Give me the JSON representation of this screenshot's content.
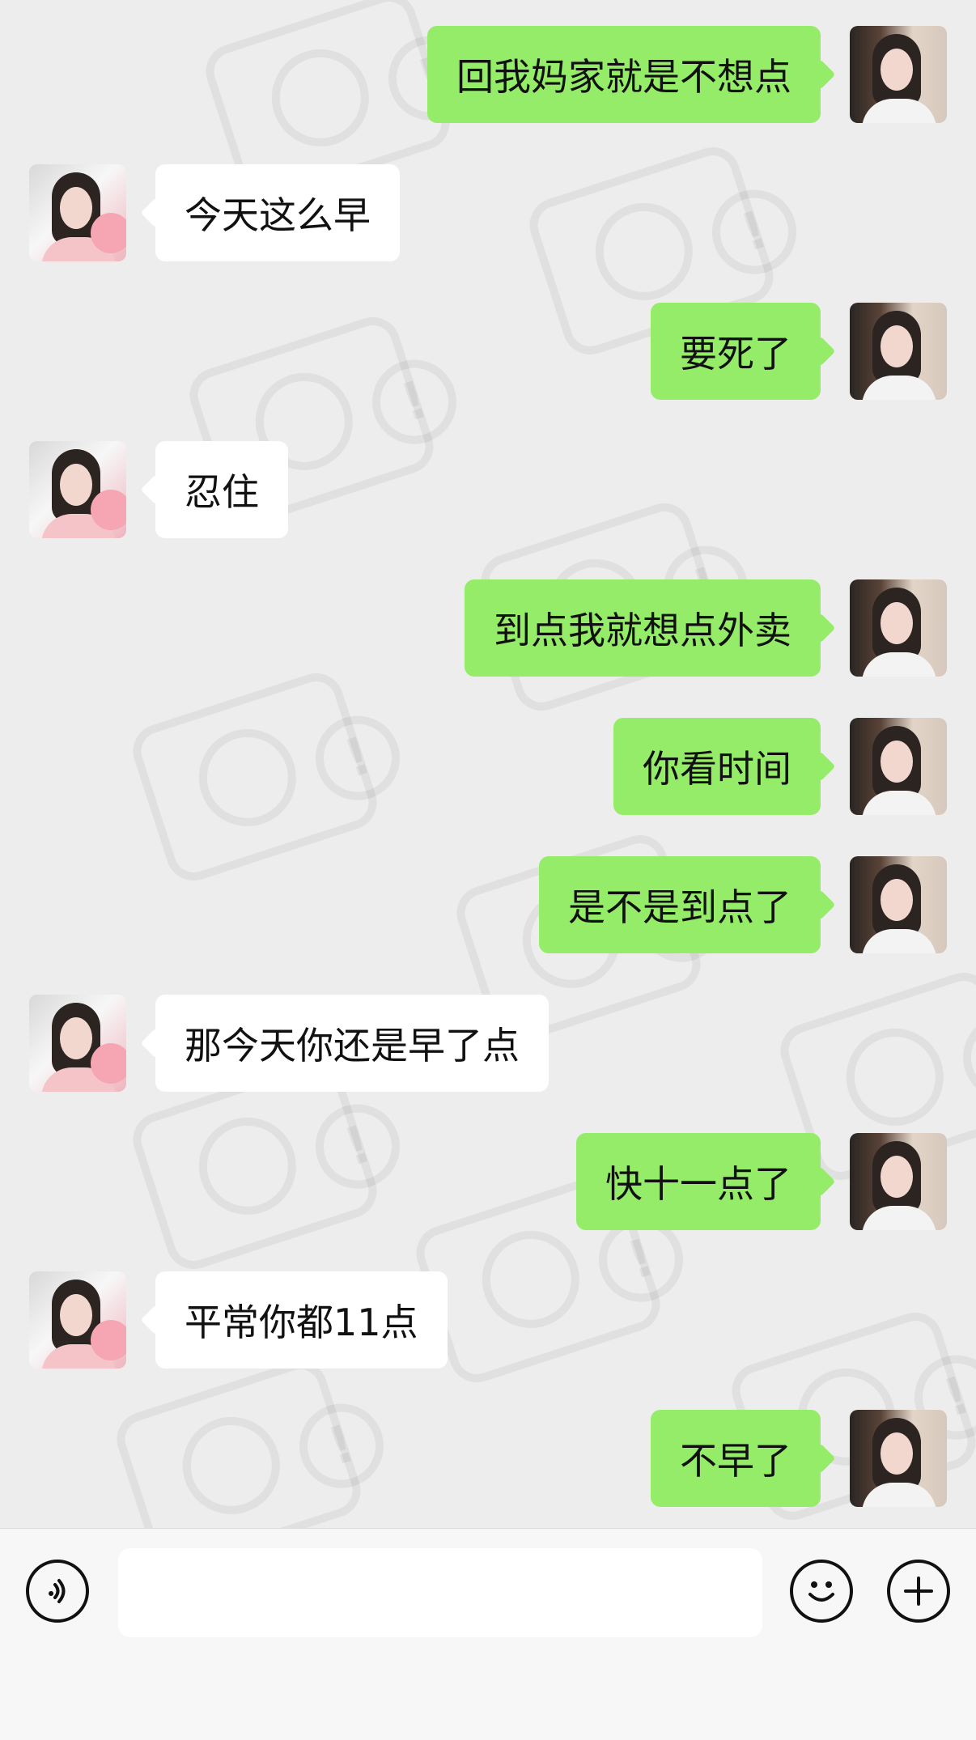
{
  "messages": [
    {
      "side": "right",
      "text": "回我妈家就是不想点"
    },
    {
      "side": "left",
      "text": "今天这么早"
    },
    {
      "side": "right",
      "text": "要死了"
    },
    {
      "side": "left",
      "text": "忍住"
    },
    {
      "side": "right",
      "text": "到点我就想点外卖"
    },
    {
      "side": "right",
      "text": "你看时间"
    },
    {
      "side": "right",
      "text": "是不是到点了"
    },
    {
      "side": "left",
      "text": "那今天你还是早了点"
    },
    {
      "side": "right",
      "text": "快十一点了"
    },
    {
      "side": "left",
      "text": "平常你都11点"
    },
    {
      "side": "right",
      "text": "不早了"
    }
  ],
  "input": {
    "value": "",
    "placeholder": ""
  },
  "icons": {
    "voice": "voice-icon",
    "emoji": "emoji-icon",
    "plus": "plus-icon"
  },
  "colors": {
    "sent_bubble": "#95ec69",
    "received_bubble": "#ffffff",
    "background": "#ededed"
  }
}
